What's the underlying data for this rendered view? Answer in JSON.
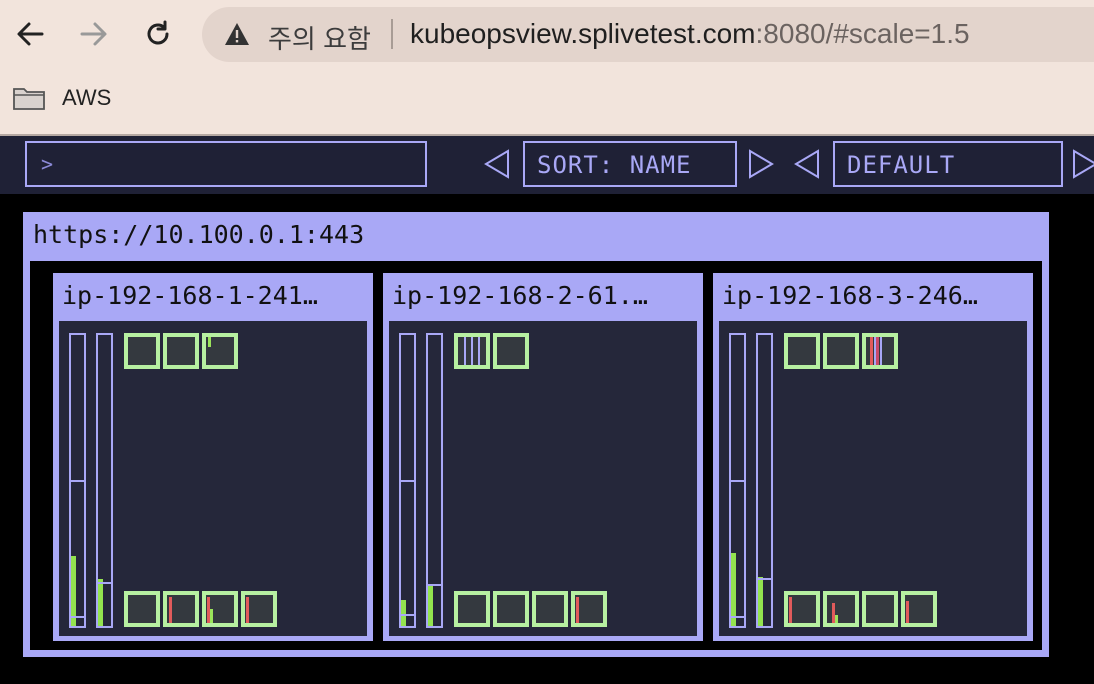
{
  "browser": {
    "security_label": "주의 요함",
    "url_host": "kubeopsview.splivetest.com",
    "url_rest": ":8080/#scale=1.5",
    "bookmark": "AWS"
  },
  "toolbar": {
    "filter_placeholder": ">",
    "sort_label": "SORT: NAME",
    "theme_label": "DEFAULT"
  },
  "cluster": {
    "name": "https://10.100.0.1:443",
    "nodes": [
      {
        "name": "ip-192-168-1-241…",
        "cpu_usage": 0.24,
        "mem_usage": 0.16,
        "top_pods": 3,
        "bottom_pods": 4
      },
      {
        "name": "ip-192-168-2-61.…",
        "cpu_usage": 0.09,
        "mem_usage": 0.14,
        "top_pods": 2,
        "bottom_pods": 4
      },
      {
        "name": "ip-192-168-3-246…",
        "cpu_usage": 0.25,
        "mem_usage": 0.17,
        "top_pods": 3,
        "bottom_pods": 4
      }
    ]
  }
}
